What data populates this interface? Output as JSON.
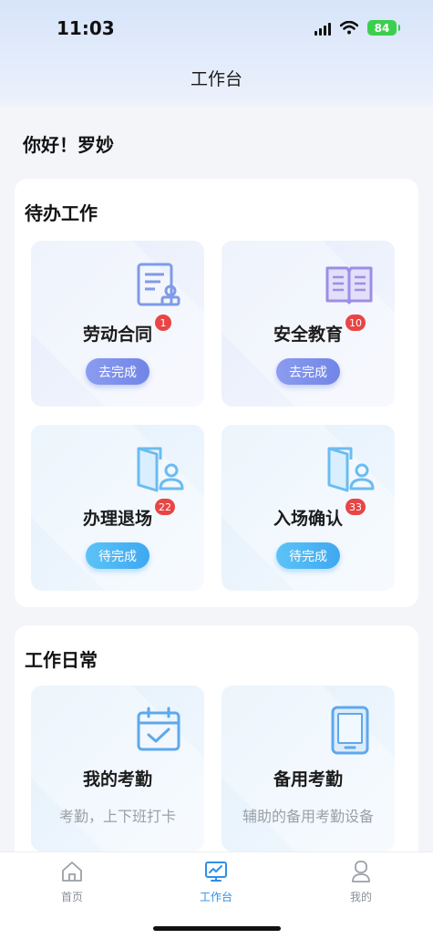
{
  "status_bar": {
    "time": "11:03",
    "battery": "84"
  },
  "header": {
    "title": "工作台"
  },
  "greeting": "你好！罗妙",
  "todo": {
    "title": "待办工作",
    "items": [
      {
        "label": "劳动合同",
        "badge": "1",
        "action": "去完成",
        "icon": "contract-icon"
      },
      {
        "label": "安全教育",
        "badge": "10",
        "action": "去完成",
        "icon": "book-icon"
      },
      {
        "label": "办理退场",
        "badge": "22",
        "action": "待完成",
        "icon": "door-person-icon"
      },
      {
        "label": "入场确认",
        "badge": "33",
        "action": "待完成",
        "icon": "door-person-icon"
      }
    ]
  },
  "daily": {
    "title": "工作日常",
    "items": [
      {
        "label": "我的考勤",
        "sub": "考勤，上下班打卡",
        "icon": "calendar-check-icon"
      },
      {
        "label": "备用考勤",
        "sub": "辅助的备用考勤设备",
        "icon": "tablet-icon"
      }
    ]
  },
  "tabbar": {
    "items": [
      {
        "label": "首页",
        "icon": "home-icon",
        "active": false
      },
      {
        "label": "工作台",
        "icon": "monitor-icon",
        "active": true
      },
      {
        "label": "我的",
        "icon": "user-icon",
        "active": false
      }
    ],
    "active_color": "#2f8fe8"
  }
}
